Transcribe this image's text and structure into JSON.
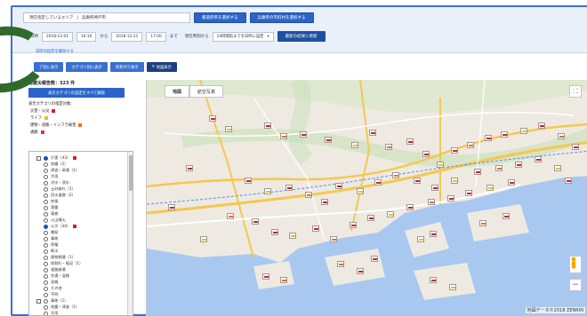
{
  "header": {
    "area_label": "現在指定しているエリア",
    "area_value": "兵庫県神戸市",
    "btn_pref": "都道府県を選択する",
    "btn_city": "兵庫県の市町村を選択する"
  },
  "date_filter": {
    "label": "日時",
    "from_date": "2018-12-01",
    "from_time": "16:10",
    "from_sep": "から",
    "to_date": "2018-12-21",
    "to_time": "17:00",
    "to_sep": "まで",
    "range_label": "現在時刻から",
    "range_value": "24時間前までを日時に設定",
    "btn_latest": "最新の結果に更新"
  },
  "cond_link": "日時の指定を解除する",
  "view_tabs": [
    "ア別に表示",
    "カテゴリ別に表示",
    "時系列で表示",
    "地図表示"
  ],
  "sidebar": {
    "count_label": "総被災報告数：323 件",
    "toggle_label": "表示カテゴリの設定をすべて解除",
    "cat_header": "表示カテゴリの指定対象：",
    "categories": [
      {
        "label": "災害・火災",
        "color": "#d42020"
      },
      {
        "label": "ライフ",
        "color": "#e8c020"
      },
      {
        "label": "建物・道路・インフラ被害",
        "color": "#e87020"
      },
      {
        "label": "通路",
        "color": "#e83030"
      }
    ],
    "tree": [
      {
        "label": "災害（43）",
        "state": "on",
        "indent": 0
      },
      {
        "label": "地震（2）",
        "state": "off",
        "indent": 1
      },
      {
        "label": "津波・高潮（1）",
        "state": "off",
        "indent": 1
      },
      {
        "label": "大雨",
        "state": "off",
        "indent": 1
      },
      {
        "label": "洪水・浸水",
        "state": "off",
        "indent": 1
      },
      {
        "label": "土砂崩れ（1）",
        "state": "off",
        "indent": 1
      },
      {
        "label": "冠水道路（2）",
        "state": "off",
        "indent": 1
      },
      {
        "label": "突風",
        "state": "off",
        "indent": 1
      },
      {
        "label": "落雷",
        "state": "off",
        "indent": 1
      },
      {
        "label": "竜巻",
        "state": "off",
        "indent": 1
      },
      {
        "label": "火山噴火",
        "state": "off",
        "indent": 1
      },
      {
        "label": "火災（34）",
        "state": "on",
        "indent": 1
      },
      {
        "label": "爆発",
        "state": "off",
        "indent": 1
      },
      {
        "label": "事故",
        "state": "off",
        "indent": 1
      },
      {
        "label": "停電",
        "state": "off",
        "indent": 1
      },
      {
        "label": "断水",
        "state": "off",
        "indent": 1
      },
      {
        "label": "建物倒壊（1）",
        "state": "off",
        "indent": 1
      },
      {
        "label": "地割れ・陥没（1）",
        "state": "off",
        "indent": 1
      },
      {
        "label": "道路崩壊",
        "state": "off",
        "indent": 1
      },
      {
        "label": "交通・混雑",
        "state": "off",
        "indent": 1
      },
      {
        "label": "混雑",
        "state": "off",
        "indent": 1
      },
      {
        "label": "その他",
        "state": "off",
        "indent": 1
      },
      {
        "label": "不明",
        "state": "off",
        "indent": 1
      },
      {
        "label": "事故（1）",
        "state": "off",
        "indent": 0
      },
      {
        "label": "地震・津波（1）",
        "state": "off",
        "indent": 1
      },
      {
        "label": "大雨",
        "state": "off",
        "indent": 1
      }
    ]
  },
  "map": {
    "tab_map": "地図",
    "tab_photo": "航空写真",
    "attribution": "地図データ©2018 ZENRIN",
    "land_color": "#eeeae2",
    "water_color": "#a8c8f0",
    "road_color": "#f4c850"
  }
}
